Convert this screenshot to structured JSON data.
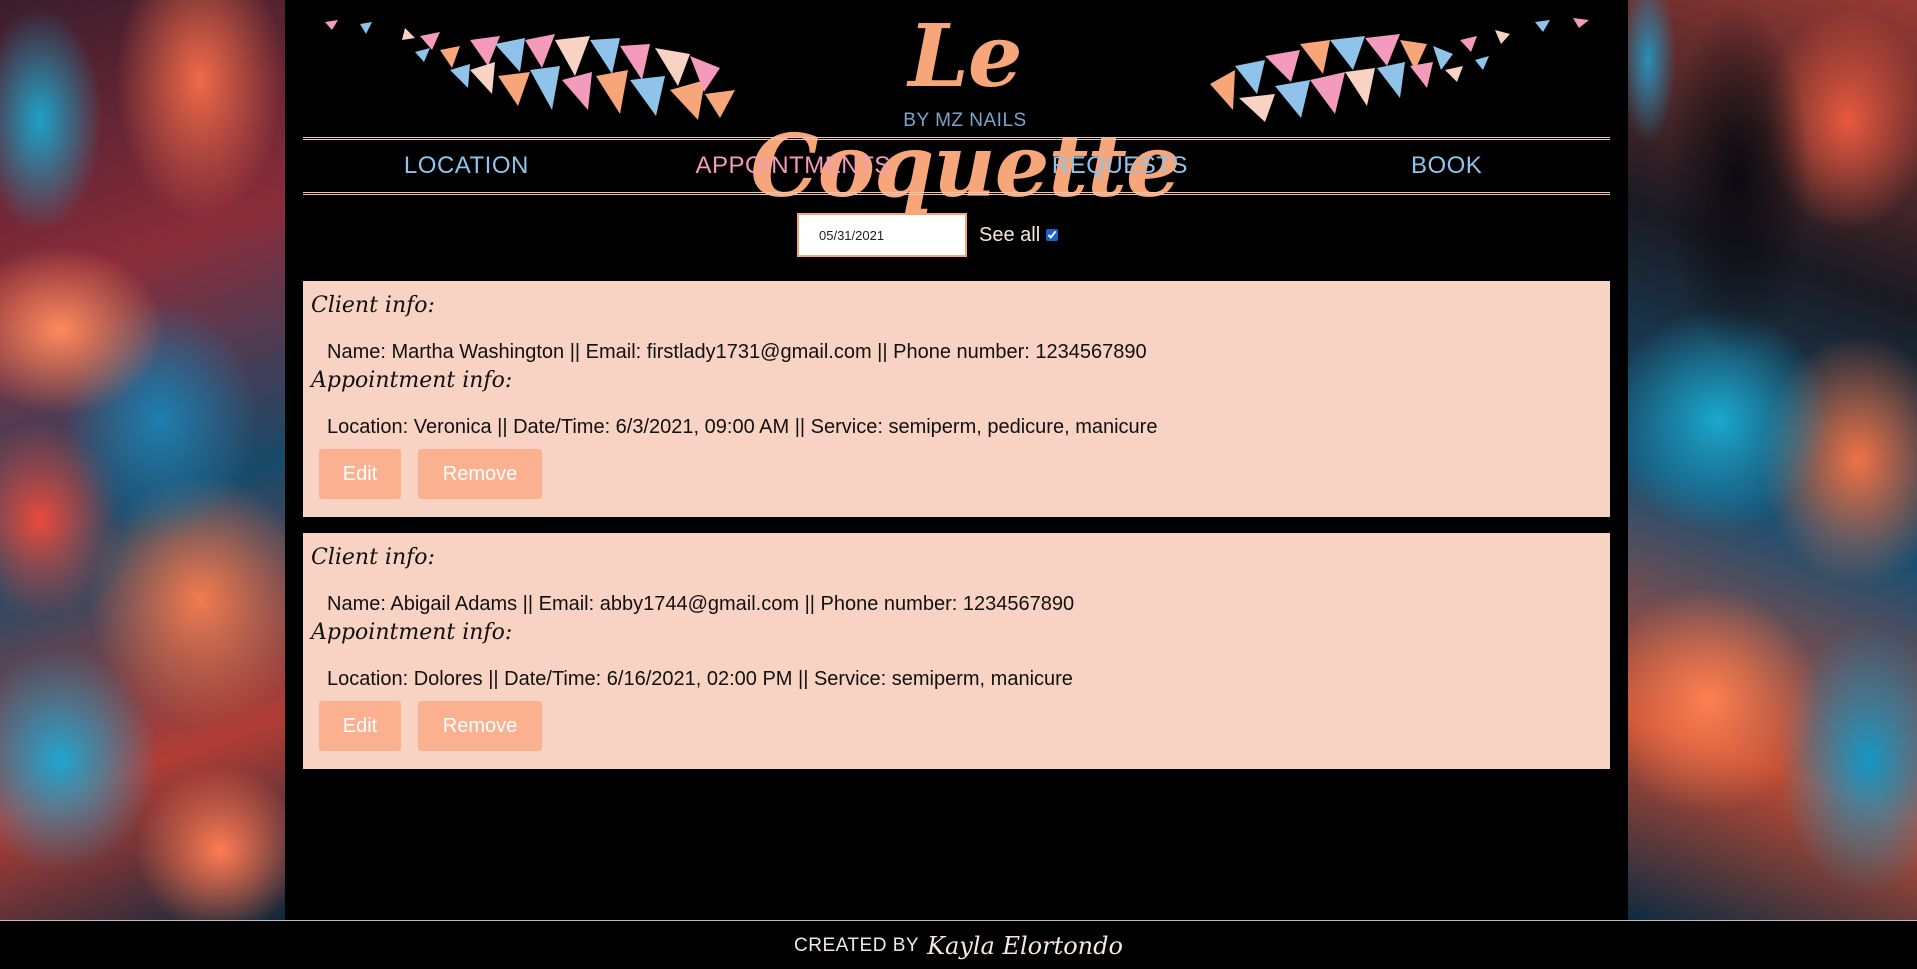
{
  "brand": {
    "title": "Le Coquette",
    "subtitle": "BY MZ NAILS"
  },
  "nav": {
    "items": [
      {
        "label": "LOCATION"
      },
      {
        "label": "APPOINTMENTS"
      },
      {
        "label": "REQUESTS"
      },
      {
        "label": "BOOK"
      }
    ],
    "active": "APPOINTMENTS"
  },
  "filter": {
    "date_value": "05/31/2021",
    "see_all_label": "See all",
    "see_all_checked": true
  },
  "appointments": [
    {
      "client_heading": "Client info:",
      "client_line": "Name: Martha Washington || Email: firstlady1731@gmail.com || Phone number: 1234567890",
      "appt_heading": "Appointment info:",
      "appt_line": "Location: Veronica || Date/Time: 6/3/2021, 09:00 AM || Service: semiperm, pedicure, manicure",
      "edit_label": "Edit",
      "remove_label": "Remove"
    },
    {
      "client_heading": "Client info:",
      "client_line": "Name: Abigail Adams || Email: abby1744@gmail.com || Phone number: 1234567890",
      "appt_heading": "Appointment info:",
      "appt_line": "Location: Dolores || Date/Time: 6/16/2021, 02:00 PM || Service: semiperm, manicure",
      "edit_label": "Edit",
      "remove_label": "Remove"
    }
  ],
  "footer": {
    "prefix": "CREATED BY",
    "name": "Kayla Elortondo"
  },
  "colors": {
    "accent_peach": "#f7a67a",
    "nav_blue": "#8fc3ea",
    "nav_active_pink": "#f39abd",
    "card_bg": "#f8d2c3",
    "button_bg": "#fbb08f"
  }
}
